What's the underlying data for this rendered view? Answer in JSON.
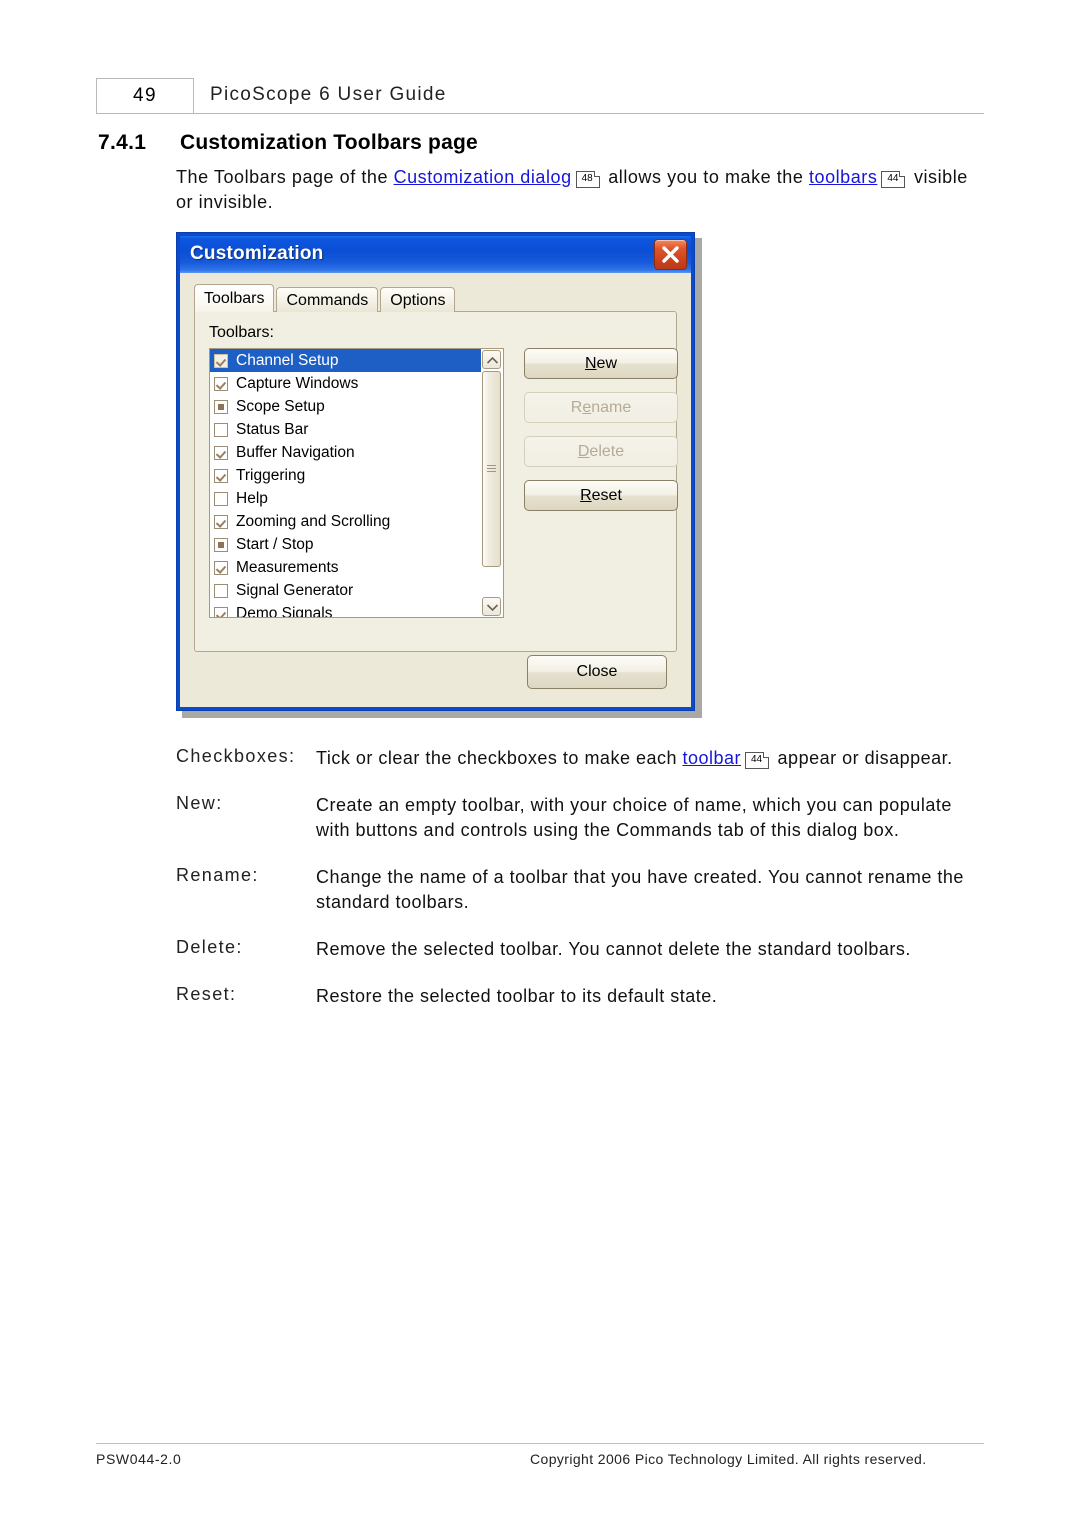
{
  "page": {
    "number": "49",
    "running_title": "PicoScope 6 User Guide",
    "section_number": "7.4.1",
    "section_title": "Customization Toolbars page"
  },
  "intro": {
    "part1": "The Toolbars page of the ",
    "link1": "Customization dialog",
    "ref1": "48",
    "part2": " allows you to make the ",
    "link2": "toolbars",
    "ref2": "44",
    "part3": " visible or invisible."
  },
  "dialog": {
    "title": "Customization",
    "close_icon": "close-icon",
    "tabs": [
      {
        "label": "Toolbars",
        "active": true
      },
      {
        "label": "Commands",
        "active": false
      },
      {
        "label": "Options",
        "active": false
      }
    ],
    "group_label": "Toolbars:",
    "toolbars": [
      {
        "label": "Channel Setup",
        "state": "checked",
        "selected": true
      },
      {
        "label": "Capture Windows",
        "state": "checked",
        "selected": false
      },
      {
        "label": "Scope Setup",
        "state": "filled",
        "selected": false
      },
      {
        "label": "Status Bar",
        "state": "empty",
        "selected": false
      },
      {
        "label": "Buffer Navigation",
        "state": "checked",
        "selected": false
      },
      {
        "label": "Triggering",
        "state": "checked",
        "selected": false
      },
      {
        "label": "Help",
        "state": "empty",
        "selected": false
      },
      {
        "label": "Zooming and Scrolling",
        "state": "checked",
        "selected": false
      },
      {
        "label": "Start / Stop",
        "state": "filled",
        "selected": false
      },
      {
        "label": "Measurements",
        "state": "checked",
        "selected": false
      },
      {
        "label": "Signal Generator",
        "state": "empty",
        "selected": false
      },
      {
        "label": "Demo Signals",
        "state": "checked",
        "selected": false
      }
    ],
    "buttons": {
      "new": {
        "pre": "",
        "mnemonic": "N",
        "post": "ew",
        "enabled": true
      },
      "rename": {
        "pre": "R",
        "mnemonic": "e",
        "post": "name",
        "enabled": false
      },
      "delete": {
        "pre": "",
        "mnemonic": "D",
        "post": "elete",
        "enabled": false
      },
      "reset": {
        "pre": "",
        "mnemonic": "R",
        "post": "eset",
        "enabled": true
      },
      "close": {
        "label": "Close"
      }
    },
    "scrollbar": {
      "up_icon": "chevron-up-icon",
      "down_icon": "chevron-down-icon"
    }
  },
  "definitions": [
    {
      "term": "Checkboxes:",
      "desc_part1": "Tick or clear the checkboxes to make each ",
      "link": "toolbar",
      "ref": "44",
      "desc_part2": " appear or disappear."
    },
    {
      "term": "New:",
      "desc": "Create an empty toolbar, with your choice of name, which you can populate with buttons and controls using the Commands tab of this dialog box."
    },
    {
      "term": "Rename:",
      "desc": "Change the name of a toolbar that you have created. You cannot rename the standard toolbars."
    },
    {
      "term": "Delete:",
      "desc": "Remove the selected toolbar. You cannot delete the standard toolbars."
    },
    {
      "term": "Reset:",
      "desc": "Restore the selected toolbar to its default state."
    }
  ],
  "footer": {
    "left": "PSW044-2.0",
    "right": "Copyright 2006 Pico Technology Limited. All rights reserved."
  },
  "colors": {
    "link": "#1515DD",
    "titlebar": "#0B4ED6",
    "selection": "#1D5FC4",
    "dialog_face": "#ECE9D8",
    "close_button": "#C8401B"
  }
}
